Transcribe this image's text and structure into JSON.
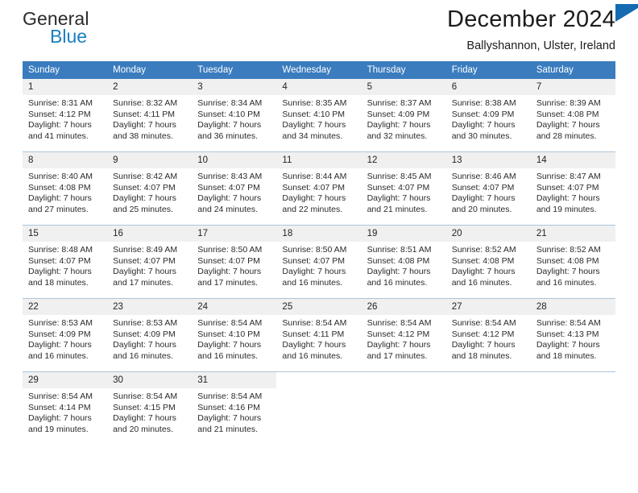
{
  "brand": {
    "name_top": "General",
    "name_bottom": "Blue",
    "triangle_color": "#156bb1",
    "bottom_color": "#1a7fc1"
  },
  "header": {
    "title": "December 2024",
    "subtitle": "Ballyshannon, Ulster, Ireland"
  },
  "theme": {
    "header_bg": "#3a7cbe",
    "header_text": "#ffffff",
    "daynum_bg": "#f0f0f0",
    "grid_line": "#adc4d9",
    "body_text": "#2a2a2a"
  },
  "weekdays": [
    "Sunday",
    "Monday",
    "Tuesday",
    "Wednesday",
    "Thursday",
    "Friday",
    "Saturday"
  ],
  "weeks": [
    [
      {
        "day": "1",
        "sunrise": "Sunrise: 8:31 AM",
        "sunset": "Sunset: 4:12 PM",
        "daylight1": "Daylight: 7 hours",
        "daylight2": "and 41 minutes."
      },
      {
        "day": "2",
        "sunrise": "Sunrise: 8:32 AM",
        "sunset": "Sunset: 4:11 PM",
        "daylight1": "Daylight: 7 hours",
        "daylight2": "and 38 minutes."
      },
      {
        "day": "3",
        "sunrise": "Sunrise: 8:34 AM",
        "sunset": "Sunset: 4:10 PM",
        "daylight1": "Daylight: 7 hours",
        "daylight2": "and 36 minutes."
      },
      {
        "day": "4",
        "sunrise": "Sunrise: 8:35 AM",
        "sunset": "Sunset: 4:10 PM",
        "daylight1": "Daylight: 7 hours",
        "daylight2": "and 34 minutes."
      },
      {
        "day": "5",
        "sunrise": "Sunrise: 8:37 AM",
        "sunset": "Sunset: 4:09 PM",
        "daylight1": "Daylight: 7 hours",
        "daylight2": "and 32 minutes."
      },
      {
        "day": "6",
        "sunrise": "Sunrise: 8:38 AM",
        "sunset": "Sunset: 4:09 PM",
        "daylight1": "Daylight: 7 hours",
        "daylight2": "and 30 minutes."
      },
      {
        "day": "7",
        "sunrise": "Sunrise: 8:39 AM",
        "sunset": "Sunset: 4:08 PM",
        "daylight1": "Daylight: 7 hours",
        "daylight2": "and 28 minutes."
      }
    ],
    [
      {
        "day": "8",
        "sunrise": "Sunrise: 8:40 AM",
        "sunset": "Sunset: 4:08 PM",
        "daylight1": "Daylight: 7 hours",
        "daylight2": "and 27 minutes."
      },
      {
        "day": "9",
        "sunrise": "Sunrise: 8:42 AM",
        "sunset": "Sunset: 4:07 PM",
        "daylight1": "Daylight: 7 hours",
        "daylight2": "and 25 minutes."
      },
      {
        "day": "10",
        "sunrise": "Sunrise: 8:43 AM",
        "sunset": "Sunset: 4:07 PM",
        "daylight1": "Daylight: 7 hours",
        "daylight2": "and 24 minutes."
      },
      {
        "day": "11",
        "sunrise": "Sunrise: 8:44 AM",
        "sunset": "Sunset: 4:07 PM",
        "daylight1": "Daylight: 7 hours",
        "daylight2": "and 22 minutes."
      },
      {
        "day": "12",
        "sunrise": "Sunrise: 8:45 AM",
        "sunset": "Sunset: 4:07 PM",
        "daylight1": "Daylight: 7 hours",
        "daylight2": "and 21 minutes."
      },
      {
        "day": "13",
        "sunrise": "Sunrise: 8:46 AM",
        "sunset": "Sunset: 4:07 PM",
        "daylight1": "Daylight: 7 hours",
        "daylight2": "and 20 minutes."
      },
      {
        "day": "14",
        "sunrise": "Sunrise: 8:47 AM",
        "sunset": "Sunset: 4:07 PM",
        "daylight1": "Daylight: 7 hours",
        "daylight2": "and 19 minutes."
      }
    ],
    [
      {
        "day": "15",
        "sunrise": "Sunrise: 8:48 AM",
        "sunset": "Sunset: 4:07 PM",
        "daylight1": "Daylight: 7 hours",
        "daylight2": "and 18 minutes."
      },
      {
        "day": "16",
        "sunrise": "Sunrise: 8:49 AM",
        "sunset": "Sunset: 4:07 PM",
        "daylight1": "Daylight: 7 hours",
        "daylight2": "and 17 minutes."
      },
      {
        "day": "17",
        "sunrise": "Sunrise: 8:50 AM",
        "sunset": "Sunset: 4:07 PM",
        "daylight1": "Daylight: 7 hours",
        "daylight2": "and 17 minutes."
      },
      {
        "day": "18",
        "sunrise": "Sunrise: 8:50 AM",
        "sunset": "Sunset: 4:07 PM",
        "daylight1": "Daylight: 7 hours",
        "daylight2": "and 16 minutes."
      },
      {
        "day": "19",
        "sunrise": "Sunrise: 8:51 AM",
        "sunset": "Sunset: 4:08 PM",
        "daylight1": "Daylight: 7 hours",
        "daylight2": "and 16 minutes."
      },
      {
        "day": "20",
        "sunrise": "Sunrise: 8:52 AM",
        "sunset": "Sunset: 4:08 PM",
        "daylight1": "Daylight: 7 hours",
        "daylight2": "and 16 minutes."
      },
      {
        "day": "21",
        "sunrise": "Sunrise: 8:52 AM",
        "sunset": "Sunset: 4:08 PM",
        "daylight1": "Daylight: 7 hours",
        "daylight2": "and 16 minutes."
      }
    ],
    [
      {
        "day": "22",
        "sunrise": "Sunrise: 8:53 AM",
        "sunset": "Sunset: 4:09 PM",
        "daylight1": "Daylight: 7 hours",
        "daylight2": "and 16 minutes."
      },
      {
        "day": "23",
        "sunrise": "Sunrise: 8:53 AM",
        "sunset": "Sunset: 4:09 PM",
        "daylight1": "Daylight: 7 hours",
        "daylight2": "and 16 minutes."
      },
      {
        "day": "24",
        "sunrise": "Sunrise: 8:54 AM",
        "sunset": "Sunset: 4:10 PM",
        "daylight1": "Daylight: 7 hours",
        "daylight2": "and 16 minutes."
      },
      {
        "day": "25",
        "sunrise": "Sunrise: 8:54 AM",
        "sunset": "Sunset: 4:11 PM",
        "daylight1": "Daylight: 7 hours",
        "daylight2": "and 16 minutes."
      },
      {
        "day": "26",
        "sunrise": "Sunrise: 8:54 AM",
        "sunset": "Sunset: 4:12 PM",
        "daylight1": "Daylight: 7 hours",
        "daylight2": "and 17 minutes."
      },
      {
        "day": "27",
        "sunrise": "Sunrise: 8:54 AM",
        "sunset": "Sunset: 4:12 PM",
        "daylight1": "Daylight: 7 hours",
        "daylight2": "and 18 minutes."
      },
      {
        "day": "28",
        "sunrise": "Sunrise: 8:54 AM",
        "sunset": "Sunset: 4:13 PM",
        "daylight1": "Daylight: 7 hours",
        "daylight2": "and 18 minutes."
      }
    ],
    [
      {
        "day": "29",
        "sunrise": "Sunrise: 8:54 AM",
        "sunset": "Sunset: 4:14 PM",
        "daylight1": "Daylight: 7 hours",
        "daylight2": "and 19 minutes."
      },
      {
        "day": "30",
        "sunrise": "Sunrise: 8:54 AM",
        "sunset": "Sunset: 4:15 PM",
        "daylight1": "Daylight: 7 hours",
        "daylight2": "and 20 minutes."
      },
      {
        "day": "31",
        "sunrise": "Sunrise: 8:54 AM",
        "sunset": "Sunset: 4:16 PM",
        "daylight1": "Daylight: 7 hours",
        "daylight2": "and 21 minutes."
      },
      {
        "day": "",
        "sunrise": "",
        "sunset": "",
        "daylight1": "",
        "daylight2": ""
      },
      {
        "day": "",
        "sunrise": "",
        "sunset": "",
        "daylight1": "",
        "daylight2": ""
      },
      {
        "day": "",
        "sunrise": "",
        "sunset": "",
        "daylight1": "",
        "daylight2": ""
      },
      {
        "day": "",
        "sunrise": "",
        "sunset": "",
        "daylight1": "",
        "daylight2": ""
      }
    ]
  ]
}
